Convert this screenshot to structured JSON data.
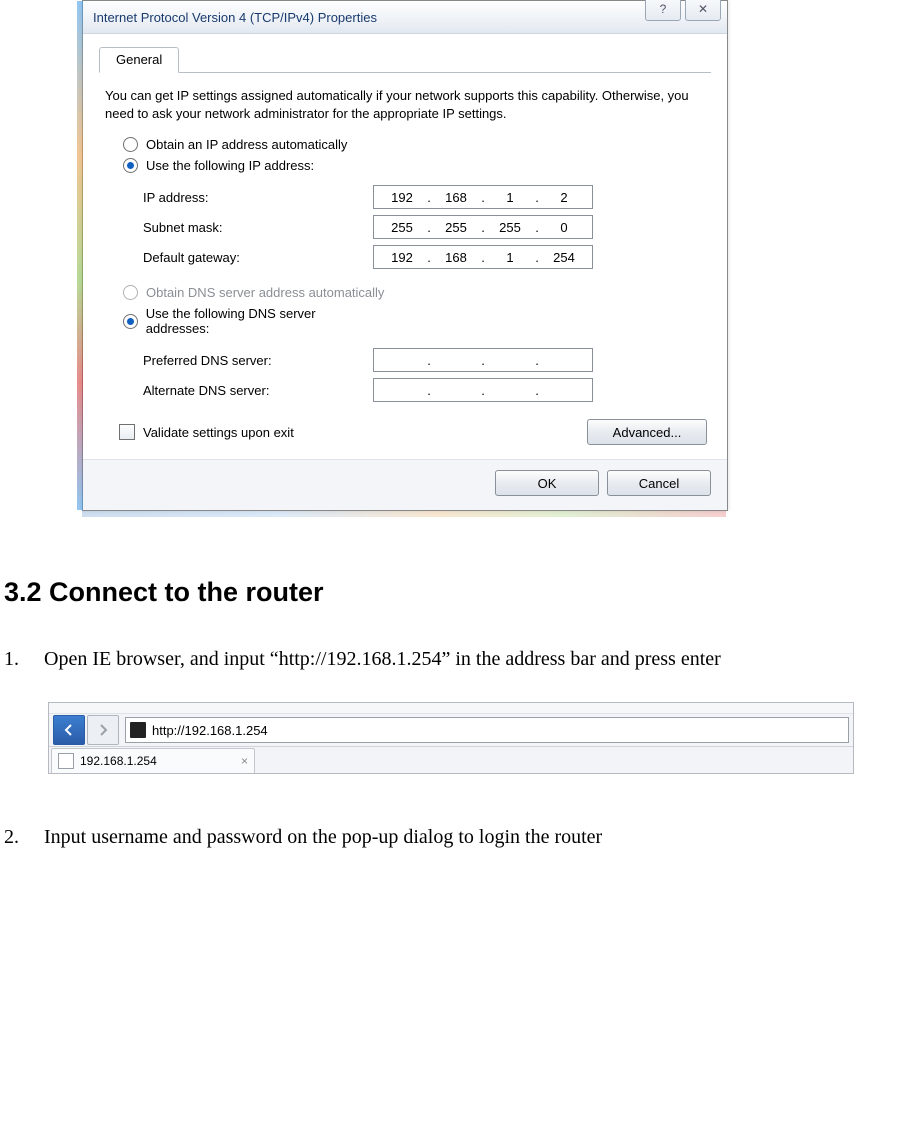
{
  "dialog": {
    "title": "Internet Protocol Version 4 (TCP/IPv4) Properties",
    "help_icon": "?",
    "close_icon": "✕",
    "tab_general": "General",
    "description": "You can get IP settings assigned automatically if your network supports this capability. Otherwise, you need to ask your network administrator for the appropriate IP settings.",
    "radio_auto_ip": "Obtain an IP address automatically",
    "radio_manual_ip": "Use the following IP address:",
    "label_ip": "IP address:",
    "label_mask": "Subnet mask:",
    "label_gw": "Default gateway:",
    "ip": {
      "a": "192",
      "b": "168",
      "c": "1",
      "d": "2"
    },
    "mask": {
      "a": "255",
      "b": "255",
      "c": "255",
      "d": "0"
    },
    "gw": {
      "a": "192",
      "b": "168",
      "c": "1",
      "d": "254"
    },
    "radio_auto_dns": "Obtain DNS server address automatically",
    "radio_manual_dns": "Use the following DNS server addresses:",
    "label_dns1": "Preferred DNS server:",
    "label_dns2": "Alternate DNS server:",
    "validate": "Validate settings upon exit",
    "advanced": "Advanced...",
    "ok": "OK",
    "cancel": "Cancel"
  },
  "doc": {
    "heading": "3.2 Connect to the router",
    "step1_num": "1.",
    "step1": "Open IE browser, and input “http://192.168.1.254” in the address bar and press enter",
    "step2_num": "2.",
    "step2": "Input username and password on the pop-up dialog to login the router"
  },
  "browser": {
    "url": "http://192.168.1.254",
    "tab_title": "192.168.1.254",
    "tab_close": "×"
  }
}
